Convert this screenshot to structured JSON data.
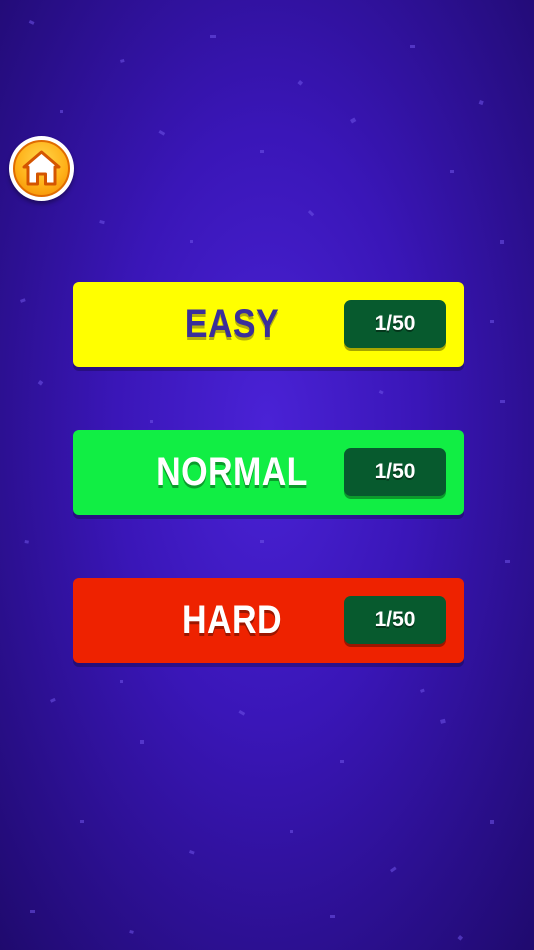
{
  "icons": {
    "home": "home-icon"
  },
  "levels": [
    {
      "label": "EASY",
      "progress": "1/50",
      "color": "#ffff00"
    },
    {
      "label": "NORMAL",
      "progress": "1/50",
      "color": "#11ee44"
    },
    {
      "label": "HARD",
      "progress": "1/50",
      "color": "#ee2200"
    }
  ],
  "colors": {
    "background": "#3a16b8",
    "badge": "#075a2e",
    "home_button": "#ffb21a"
  }
}
